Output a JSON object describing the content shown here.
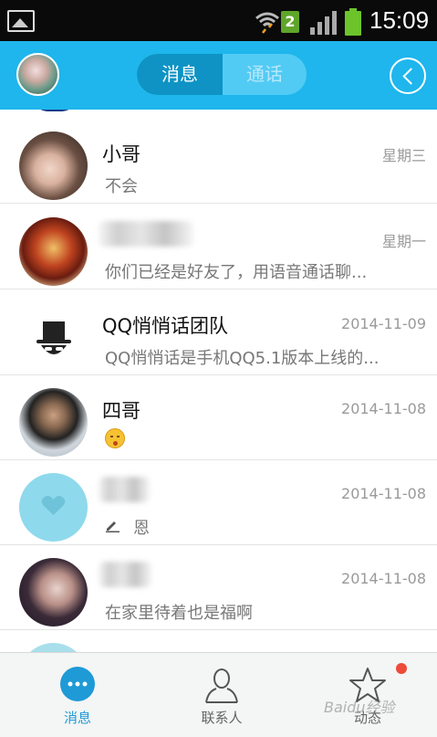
{
  "status_bar": {
    "sim_badge": "2",
    "time": "15:09",
    "icons": [
      "gallery-icon",
      "wifi-icon",
      "sim-icon",
      "signal-icon",
      "battery-icon"
    ]
  },
  "header": {
    "segment_tabs": [
      {
        "label": "消息",
        "active": true
      },
      {
        "label": "通话",
        "active": false
      }
    ],
    "accent_color": "#1eb6ec"
  },
  "conversations": [
    {
      "name": "小哥",
      "time": "星期三",
      "message": "不会",
      "avatar": "dog-avatar"
    },
    {
      "name": "",
      "time": "星期一",
      "message": "你们已经是好友了，用语音通话聊...",
      "avatar": "ironman-avatar",
      "name_blurred": true
    },
    {
      "name": "QQ悄悄话团队",
      "time": "2014-11-09",
      "message": "QQ悄悄话是手机QQ5.1版本上线的...",
      "avatar": "qq-whisper-avatar"
    },
    {
      "name": "四哥",
      "time": "2014-11-08",
      "message": "",
      "avatar": "man-avatar",
      "emoji": "grin-emoji"
    },
    {
      "name": "",
      "time": "2014-11-08",
      "message": "恩",
      "avatar": "heart-avatar",
      "name_blurred": true,
      "draft": true
    },
    {
      "name": "",
      "time": "2014-11-08",
      "message": "在家里待着也是福啊",
      "avatar": "boy-avatar",
      "name_blurred": true
    }
  ],
  "tabbar": {
    "tabs": [
      {
        "label": "消息",
        "icon": "chat-bubble-icon",
        "active": true
      },
      {
        "label": "联系人",
        "icon": "contacts-icon",
        "active": false
      },
      {
        "label": "动态",
        "icon": "star-icon",
        "active": false,
        "has_badge": true
      }
    ],
    "watermark": "Baidu经验"
  }
}
